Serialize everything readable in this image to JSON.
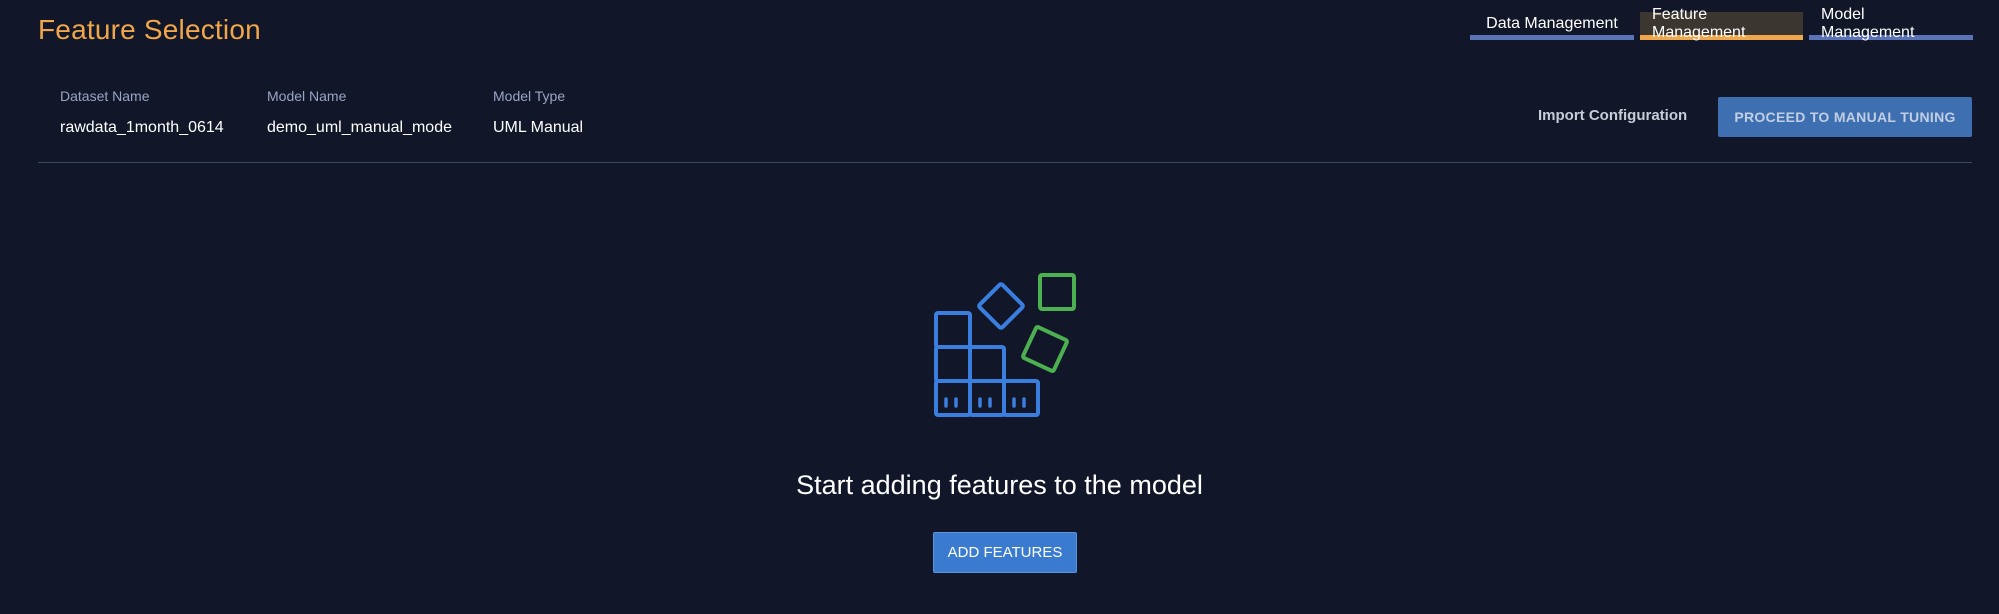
{
  "header": {
    "title": "Feature Selection"
  },
  "tabs": [
    {
      "label": "Data Management"
    },
    {
      "label": "Feature Management",
      "active": true
    },
    {
      "label": "Model Management"
    }
  ],
  "info": {
    "dataset": {
      "label": "Dataset Name",
      "value": "rawdata_1month_0614"
    },
    "model": {
      "label": "Model Name",
      "value": "demo_uml_manual_mode"
    },
    "type": {
      "label": "Model Type",
      "value": "UML Manual"
    }
  },
  "actions": {
    "import_label": "Import Configuration",
    "proceed_label": "PROCEED TO MANUAL TUNING"
  },
  "empty_state": {
    "icon": "blocks-stack-icon",
    "message": "Start adding features to the model",
    "button_label": "ADD FEATURES"
  },
  "colors": {
    "background": "#111728",
    "title_accent": "#f0a64a",
    "tab_underline": "#5a72b6",
    "primary_button": "#3a7bd0",
    "icon_blue": "#3a7fe0",
    "icon_green": "#4caf50"
  }
}
